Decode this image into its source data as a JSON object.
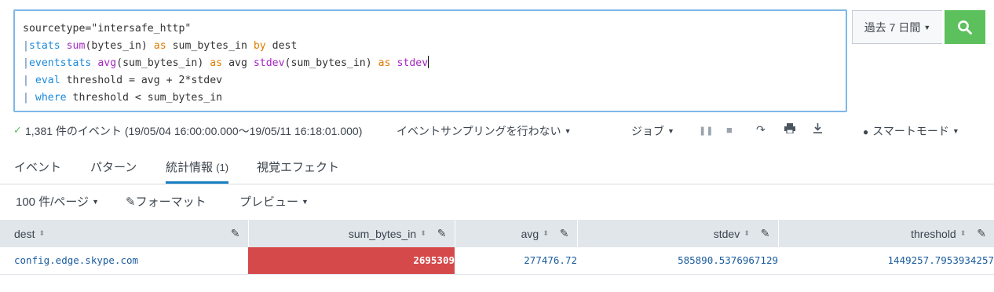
{
  "search": {
    "lines": [
      [
        {
          "t": "sourcetype=\"intersafe_http\"",
          "c": ""
        }
      ],
      [
        {
          "t": "|",
          "c": "k-pipe"
        },
        {
          "t": "stats",
          "c": "k-cmd"
        },
        {
          "t": " ",
          "c": ""
        },
        {
          "t": "sum",
          "c": "k-fn"
        },
        {
          "t": "(bytes_in) ",
          "c": ""
        },
        {
          "t": "as",
          "c": "k-kw"
        },
        {
          "t": " sum_bytes_in ",
          "c": ""
        },
        {
          "t": "by",
          "c": "k-kw"
        },
        {
          "t": " dest",
          "c": ""
        }
      ],
      [
        {
          "t": "|",
          "c": "k-pipe"
        },
        {
          "t": "eventstats",
          "c": "k-cmd"
        },
        {
          "t": " ",
          "c": ""
        },
        {
          "t": "avg",
          "c": "k-fn"
        },
        {
          "t": "(sum_bytes_in) ",
          "c": ""
        },
        {
          "t": "as",
          "c": "k-kw"
        },
        {
          "t": " avg ",
          "c": ""
        },
        {
          "t": "stdev",
          "c": "k-fn"
        },
        {
          "t": "(sum_bytes_in) ",
          "c": ""
        },
        {
          "t": "as",
          "c": "k-kw"
        },
        {
          "t": " ",
          "c": ""
        },
        {
          "t": "stdev",
          "c": "k-fn"
        }
      ],
      [
        {
          "t": "| ",
          "c": "k-pipe"
        },
        {
          "t": "eval",
          "c": "k-cmd"
        },
        {
          "t": " threshold = avg + 2*stdev",
          "c": ""
        }
      ],
      [
        {
          "t": "| ",
          "c": "k-pipe"
        },
        {
          "t": "where",
          "c": "k-cmd"
        },
        {
          "t": " threshold < sum_bytes_in",
          "c": ""
        }
      ]
    ],
    "timerange_label": "過去 7 日間",
    "search_icon": "search-icon",
    "search_button_color": "#5cc05c"
  },
  "status": {
    "check_icon": "check-icon",
    "events_text": "1,381 件のイベント (19/05/04 16:00:00.000〜19/05/11 16:18:01.000)",
    "sampling_label": "イベントサンプリングを行わない",
    "job_label": "ジョブ",
    "mode_label": "スマートモード"
  },
  "tabs": [
    {
      "label": "イベント"
    },
    {
      "label": "パターン"
    },
    {
      "label": "統計情報",
      "count": "(1)"
    },
    {
      "label": "視覚エフェクト"
    }
  ],
  "toolbar": {
    "per_page_label": "100 件/ページ",
    "format_label": "フォーマット",
    "preview_label": "プレビュー"
  },
  "table": {
    "columns": [
      "dest",
      "sum_bytes_in",
      "avg",
      "stdev",
      "threshold"
    ],
    "rows": [
      [
        "config.edge.skype.com",
        "2695309",
        "277476.72",
        "585890.5376967129",
        "1449257.7953934257"
      ]
    ],
    "heat_color": "#d6494a"
  }
}
